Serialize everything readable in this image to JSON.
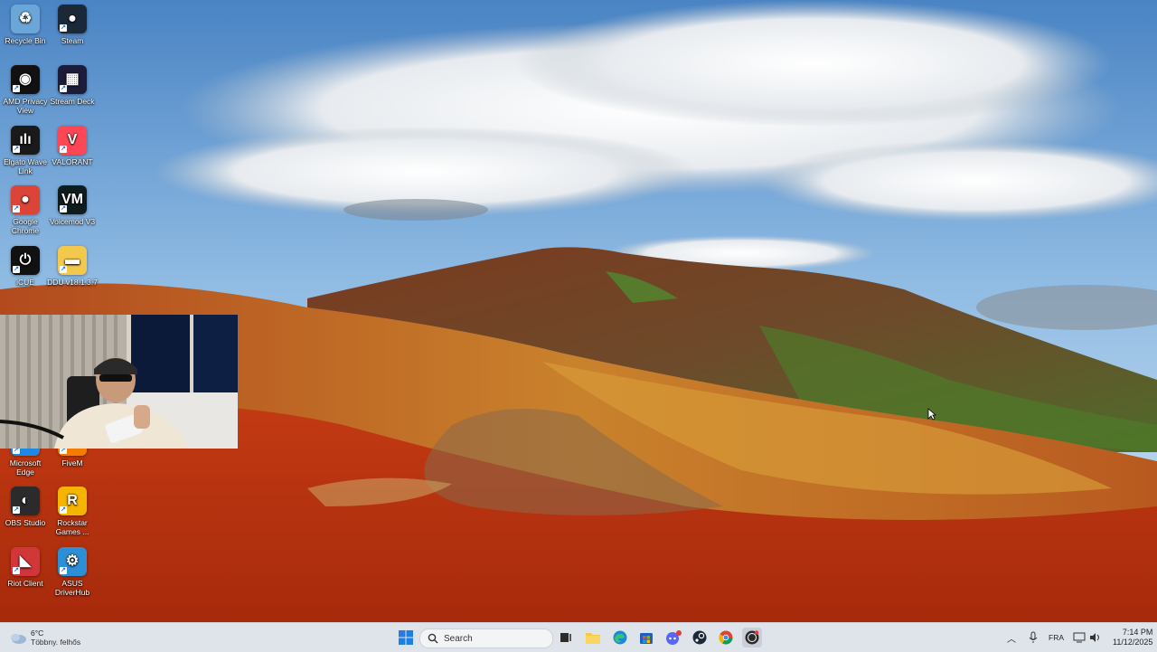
{
  "desktop": {
    "icons": [
      {
        "label": "Recycle Bin",
        "icon": "recycle-bin-icon",
        "glyph": "♻",
        "color": "#6aa6d8"
      },
      {
        "label": "Steam",
        "icon": "steam-icon",
        "glyph": "●",
        "color": "#1b2838"
      },
      {
        "label": "AMD Privacy View",
        "icon": "amd-privacy-view-icon",
        "glyph": "◉",
        "color": "#111111"
      },
      {
        "label": "Stream Deck",
        "icon": "stream-deck-icon",
        "glyph": "▦",
        "color": "#1c1c3a"
      },
      {
        "label": "Elgato Wave Link",
        "icon": "elgato-wave-link-icon",
        "glyph": "ılı",
        "color": "#1a1a1a"
      },
      {
        "label": "VALORANT",
        "icon": "valorant-icon",
        "glyph": "V",
        "color": "#ff4655"
      },
      {
        "label": "Google Chrome",
        "icon": "chrome-icon",
        "glyph": "●",
        "color": "#db4437"
      },
      {
        "label": "Voicemod V3",
        "icon": "voicemod-icon",
        "glyph": "VM",
        "color": "#0f1c1e"
      },
      {
        "label": "iCUE",
        "icon": "icue-icon",
        "glyph": "⏻",
        "color": "#111111"
      },
      {
        "label": "DDU v18.1.3.7",
        "icon": "ddu-folder-icon",
        "glyph": "▬",
        "color": "#f2c94c"
      },
      {
        "label": "Microsoft Edge",
        "icon": "edge-icon",
        "glyph": "e",
        "color": "#1e88e5"
      },
      {
        "label": "FiveM",
        "icon": "fivem-icon",
        "glyph": "F",
        "color": "#f57c00"
      },
      {
        "label": "OBS Studio",
        "icon": "obs-studio-icon",
        "glyph": "◐",
        "color": "#2b2b2b"
      },
      {
        "label": "Rockstar Games ...",
        "icon": "rockstar-games-icon",
        "glyph": "R",
        "color": "#f4b400"
      },
      {
        "label": "Riot Client",
        "icon": "riot-client-icon",
        "glyph": "◣",
        "color": "#d13639"
      },
      {
        "label": "ASUS DriverHub",
        "icon": "asus-driverhub-icon",
        "glyph": "⚙",
        "color": "#2d8fd5"
      }
    ]
  },
  "taskbar": {
    "weather": {
      "temp": "6°C",
      "desc": "Többny. felhős"
    },
    "search_placeholder": "Search",
    "apps": [
      {
        "name": "start-button",
        "icon": "windows-icon"
      },
      {
        "name": "task-view",
        "icon": "task-view-icon"
      },
      {
        "name": "file-explorer",
        "icon": "folder-icon"
      },
      {
        "name": "edge",
        "icon": "edge-icon"
      },
      {
        "name": "microsoft-store",
        "icon": "store-icon"
      },
      {
        "name": "discord",
        "icon": "discord-icon"
      },
      {
        "name": "steam",
        "icon": "steam-icon"
      },
      {
        "name": "chrome",
        "icon": "chrome-icon"
      },
      {
        "name": "obs",
        "icon": "obs-icon"
      }
    ],
    "tray": {
      "language": "FRA",
      "time": "7:14 PM",
      "date": "11/12/2025"
    }
  }
}
